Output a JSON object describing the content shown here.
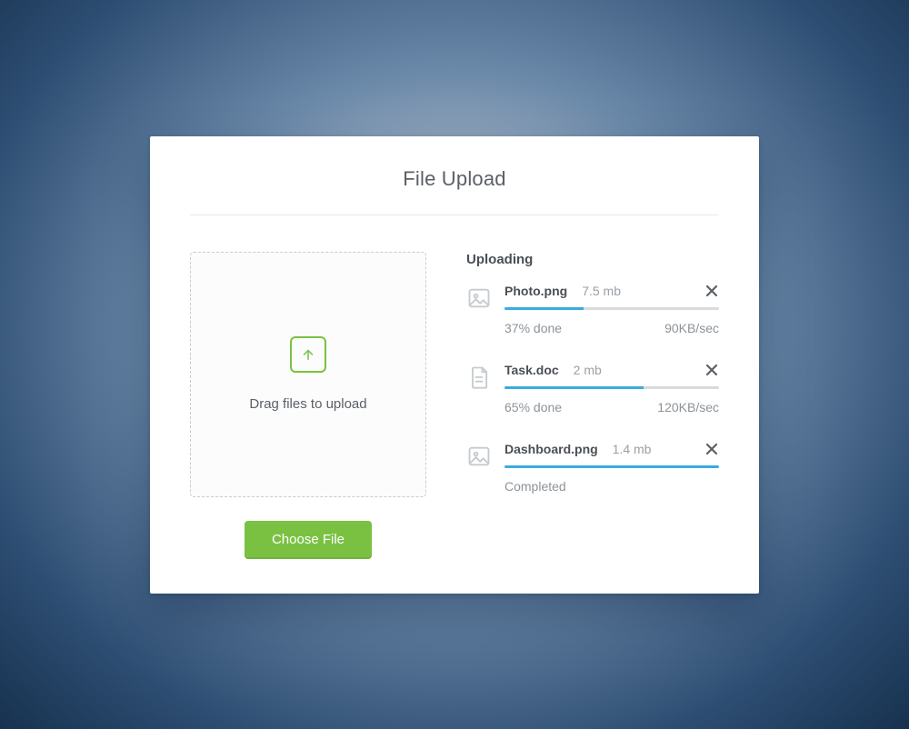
{
  "title": "File Upload",
  "dropzone": {
    "label": "Drag files to upload"
  },
  "choose_button": {
    "label": "Choose File"
  },
  "uploading": {
    "heading": "Uploading",
    "files": [
      {
        "icon": "image",
        "name": "Photo.png",
        "size": "7.5 mb",
        "progress_percent": 37,
        "status": "37% done",
        "speed": "90KB/sec"
      },
      {
        "icon": "document",
        "name": "Task.doc",
        "size": "2 mb",
        "progress_percent": 65,
        "status": "65% done",
        "speed": "120KB/sec"
      },
      {
        "icon": "image",
        "name": "Dashboard.png",
        "size": "1.4 mb",
        "progress_percent": 100,
        "status": "Completed",
        "speed": ""
      }
    ]
  },
  "colors": {
    "accent_green": "#7ac142",
    "accent_blue": "#3baadf"
  }
}
